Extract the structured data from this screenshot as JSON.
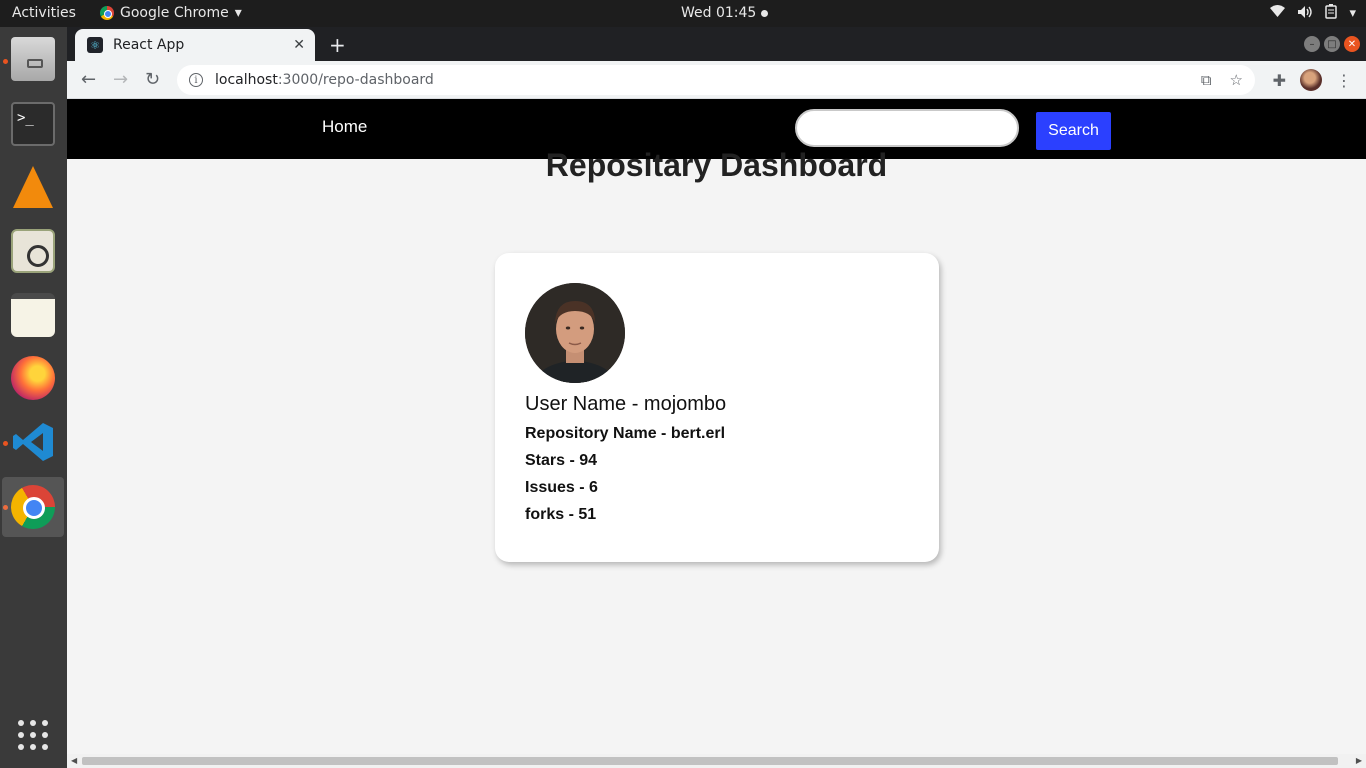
{
  "system": {
    "activities": "Activities",
    "app_menu": "Google Chrome",
    "clock": "Wed 01:45"
  },
  "browser": {
    "tab_title": "React App",
    "url_host": "localhost",
    "url_path": ":3000/repo-dashboard"
  },
  "nav": {
    "home_label": "Home",
    "search_placeholder": "",
    "search_value": "",
    "search_button": "Search"
  },
  "page": {
    "title": "Repositary Dashboard"
  },
  "card": {
    "user": "User Name - mojombo",
    "repo": "Repository Name - bert.erl",
    "stars": "Stars - 94",
    "issues": "Issues - 6",
    "forks": "forks - 51"
  },
  "colors": {
    "navbar": "#000000",
    "search_button": "#2b40ff",
    "background": "#f4f4f4"
  }
}
